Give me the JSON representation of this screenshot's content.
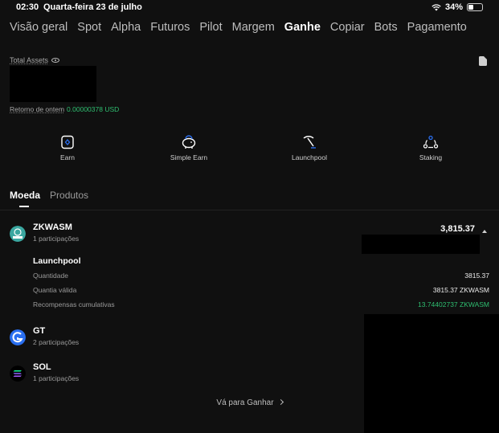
{
  "status": {
    "time": "02:30",
    "date": "Quarta-feira 23 de julho",
    "battery": "34%",
    "battery_level": 0.34
  },
  "nav": {
    "items": [
      "Visão geral",
      "Spot",
      "Alpha",
      "Futuros",
      "Pilot",
      "Margem",
      "Ganhe",
      "Copiar",
      "Bots",
      "Pagamento"
    ],
    "active": "Ganhe"
  },
  "assets": {
    "total_label": "Total Assets",
    "return_label": "Retorno de ontem",
    "return_value": "0.00000378 USD"
  },
  "quick_actions": [
    {
      "label": "Earn",
      "icon": "earn-icon"
    },
    {
      "label": "Simple Earn",
      "icon": "piggy-bank-icon"
    },
    {
      "label": "Launchpool",
      "icon": "pickaxe-icon"
    },
    {
      "label": "Staking",
      "icon": "staking-icon"
    }
  ],
  "tabs": [
    "Moeda",
    "Produtos"
  ],
  "coins": [
    {
      "name": "ZKWASM",
      "sub": "1 participações",
      "amount": "3,815.37",
      "logo_color": "#3aa7a0"
    },
    {
      "name": "GT",
      "sub": "2 participações",
      "logo_color": "#2a6ff0"
    },
    {
      "name": "SOL",
      "sub": "1 participações",
      "logo_color": "#000000"
    }
  ],
  "launchpool": {
    "title": "Launchpool",
    "rows": [
      {
        "label": "Quantidade",
        "value": "3815.37"
      },
      {
        "label": "Quantia válida",
        "value": "3815.37 ZKWASM"
      },
      {
        "label": "Recompensas cumulativas",
        "value": "13.74402737 ZKWASM"
      }
    ]
  },
  "goto_label": "Vá para Ganhar",
  "colors": {
    "accent_green": "#2fbf71",
    "background": "#101010"
  }
}
